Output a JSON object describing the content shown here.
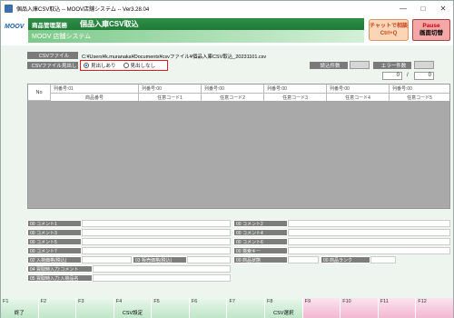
{
  "window": {
    "title": "個品入庫CSV取込 -- MOOV店舗システム -- Ver3.28.04"
  },
  "header": {
    "logo": "MOOV",
    "category": "商品管理業務",
    "screen_title": "個品入庫CSV取込",
    "system_name": "MOOV 店舗システム",
    "chat_line1": "チャットで相談",
    "chat_line2": "Ctrl+Q",
    "pause_line1": "Pause",
    "pause_line2": "画面切替"
  },
  "form": {
    "csv_file_label": "CSVファイル",
    "csv_file_path": "C:¥Users¥k.muranaka¥Documents¥csvファイル¥個品入庫CSV取込_20231101.csv",
    "heading_label": "CSVファイル見出し",
    "heading_option_yes": "見出しあり",
    "heading_option_no": "見出しなし",
    "heading_selected": "見出しあり",
    "read_count_label": "読込件数",
    "read_count": "",
    "error_count_label": "エラー件数",
    "error_count": "",
    "progress_current": "0",
    "progress_sep": "/",
    "progress_total": "0"
  },
  "grid": {
    "no_label": "No",
    "top_headers": [
      "列番号:01",
      "列番号:00",
      "列番号:00",
      "列番号:00",
      "列番号:00",
      "列番号:00"
    ],
    "bottom_headers": [
      "商品番号",
      "任意コード1",
      "任意コード2",
      "任意コード3",
      "任意コード4",
      "任意コード5"
    ]
  },
  "fields": {
    "c1": "00 コメント1",
    "c2": "00 コメント2",
    "c3": "00 コメント3",
    "c4": "00 コメント4",
    "c5": "00 コメント5",
    "c6": "00 コメント6",
    "c7": "00 コメント7",
    "search": "00 検索キー",
    "stock_price": "02 入荷価格(税込)",
    "sale_price": "03 販売価格(税込)",
    "condition": "00 商品状態",
    "rank": "00 商品ランク",
    "buy_comment": "04 買取時入力:コメント",
    "buy_name": "05 買取時入力:入荷品名"
  },
  "fkeys": [
    {
      "key": "F1",
      "label": "終了"
    },
    {
      "key": "F2",
      "label": ""
    },
    {
      "key": "F3",
      "label": ""
    },
    {
      "key": "F4",
      "label": "CSV設定"
    },
    {
      "key": "F5",
      "label": ""
    },
    {
      "key": "F6",
      "label": ""
    },
    {
      "key": "F7",
      "label": ""
    },
    {
      "key": "F8",
      "label": "CSV選択"
    },
    {
      "key": "F9",
      "label": ""
    },
    {
      "key": "F10",
      "label": ""
    },
    {
      "key": "F11",
      "label": ""
    },
    {
      "key": "F12",
      "label": ""
    }
  ]
}
